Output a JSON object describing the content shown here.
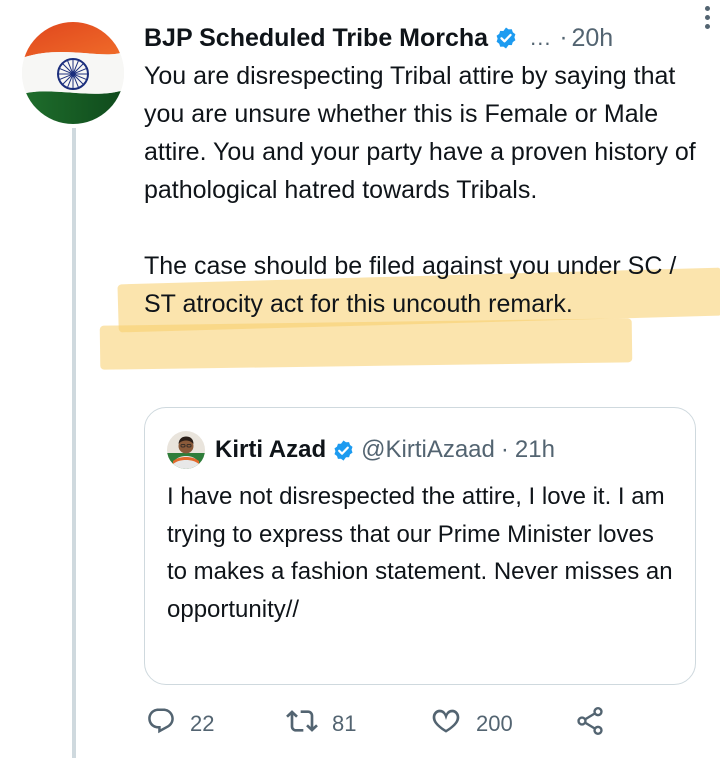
{
  "tweet": {
    "author_name": "BJP Scheduled Tribe Morcha",
    "ellipsis": "...",
    "separator": "·",
    "time": "20h",
    "paragraph_1": "You are disrespecting Tribal attire by saying that you are unsure whether this is Female or Male attire. You and your party have a proven history of pathological hatred towards Tribals.",
    "paragraph_2": "The case should be filed against you under SC / ST atrocity act for this uncouth remark.",
    "highlight_color": "#F8CD69"
  },
  "quoted_tweet": {
    "author_name": "Kirti Azad",
    "handle": "@KirtiAzaad",
    "separator": "·",
    "time": "21h",
    "text": "I have not disrespected the attire, I love it. I am trying to express that our Prime Minister loves to makes a fashion statement. Never misses an opportunity//"
  },
  "actions": {
    "reply_count": "22",
    "retweet_count": "81",
    "like_count": "200"
  },
  "icons": [
    "verified-badge-icon",
    "more-options-icon",
    "reply-icon",
    "retweet-icon",
    "like-icon",
    "share-icon"
  ],
  "colors": {
    "verified": "#1D9BF0",
    "secondary_text": "#536471",
    "border": "#CFD9DE"
  }
}
